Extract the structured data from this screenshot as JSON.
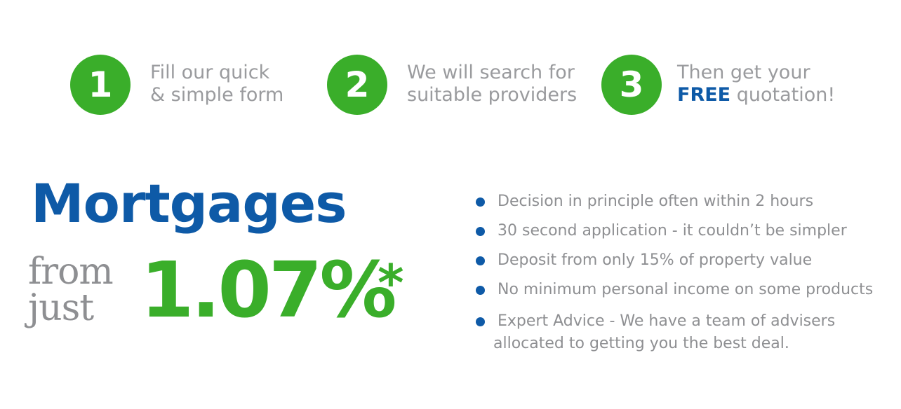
{
  "colors": {
    "green": "#3aae2a",
    "blue": "#0e5aa7",
    "grey": "#8e8f92"
  },
  "steps": [
    {
      "number": "1",
      "line1": "Fill our quick",
      "line2": "& simple form"
    },
    {
      "number": "2",
      "line1": "We will search for",
      "line2": "suitable providers"
    },
    {
      "number": "3",
      "line1": "Then get your",
      "line2_bold": "FREE",
      "line2": " quotation!"
    }
  ],
  "headline": {
    "title": "Mortgages",
    "from": "from",
    "just": "just",
    "rate": "1.07%",
    "rate_mark": "*"
  },
  "benefits": [
    "Decision in principle often within 2 hours",
    "30 second application - it couldn’t be simpler",
    "Deposit from only 15% of property value",
    "No minimum personal income on some products"
  ],
  "benefit_last": {
    "line1": "Expert Advice - We have a team of advisers",
    "line2": "allocated to getting you the best deal."
  }
}
